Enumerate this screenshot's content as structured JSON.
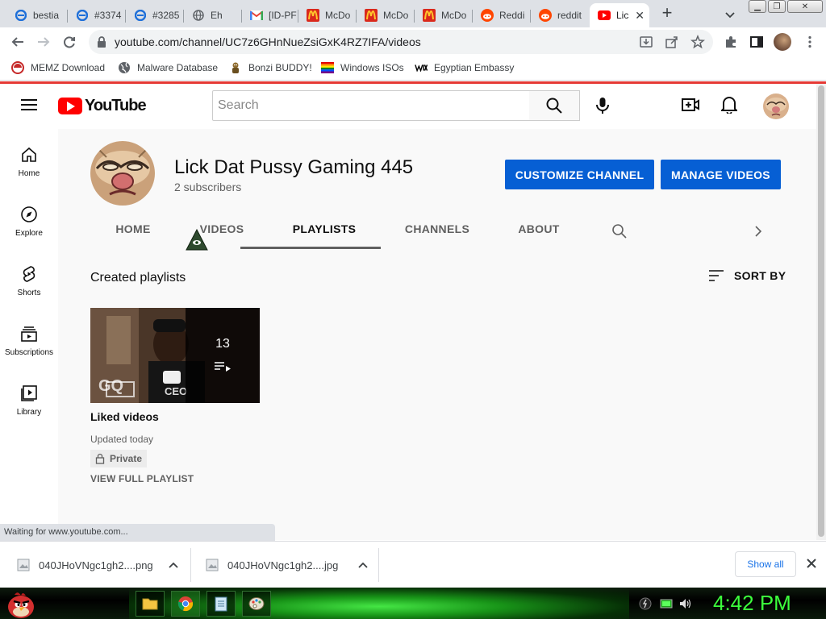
{
  "browser": {
    "tabs": [
      {
        "label": "bestia",
        "icon": "ie-icon"
      },
      {
        "label": "#3374",
        "icon": "ie-icon"
      },
      {
        "label": "#3285",
        "icon": "ie-icon"
      },
      {
        "label": "Eh",
        "icon": "globe-icon"
      },
      {
        "label": "[ID-PF",
        "icon": "gmail-icon"
      },
      {
        "label": "McDo",
        "icon": "mcdonalds-icon"
      },
      {
        "label": "McDo",
        "icon": "mcdonalds-icon"
      },
      {
        "label": "McDo",
        "icon": "mcdonalds-icon"
      },
      {
        "label": "Reddi",
        "icon": "reddit-icon"
      },
      {
        "label": "reddit",
        "icon": "reddit-icon"
      },
      {
        "label": "Lic",
        "icon": "youtube-icon",
        "active": true
      }
    ],
    "url": "youtube.com/channel/UC7z6GHnNueZsiGxK4RZ7IFA/videos",
    "bookmarks": [
      {
        "label": "MEMZ Download",
        "icon": "memz-icon"
      },
      {
        "label": "Malware Database",
        "icon": "globe-icon"
      },
      {
        "label": "Bonzi BUDDY!",
        "icon": "bonzi-icon"
      },
      {
        "label": "Windows ISOs",
        "icon": "rainbow-flag-icon"
      },
      {
        "label": "Egyptian Embassy",
        "icon": "wix-icon"
      }
    ],
    "status_text": "Waiting for www.youtube.com..."
  },
  "youtube": {
    "logo_text": "YouTube",
    "search_placeholder": "Search",
    "guide": [
      {
        "label": "Home",
        "icon": "home-icon"
      },
      {
        "label": "Explore",
        "icon": "compass-icon"
      },
      {
        "label": "Shorts",
        "icon": "shorts-icon"
      },
      {
        "label": "Subscriptions",
        "icon": "subscriptions-icon"
      },
      {
        "label": "Library",
        "icon": "library-icon"
      }
    ],
    "channel": {
      "name": "Lick Dat Pussy Gaming 445",
      "subscribers": "2 subscribers",
      "customize_label": "CUSTOMIZE CHANNEL",
      "manage_label": "MANAGE VIDEOS",
      "tabs": [
        "HOME",
        "VIDEOS",
        "PLAYLISTS",
        "CHANNELS",
        "ABOUT"
      ],
      "active_tab": "PLAYLISTS"
    },
    "section": {
      "title": "Created playlists",
      "sort_label": "SORT BY"
    },
    "playlist": {
      "title": "Liked videos",
      "count": "13",
      "updated": "Updated today",
      "privacy": "Private",
      "view_full": "VIEW FULL PLAYLIST",
      "thumb_watermark": "GQ",
      "thumb_text": "CEO"
    }
  },
  "downloads": {
    "items": [
      {
        "filename": "040JHoVNgc1gh2....png"
      },
      {
        "filename": "040JHoVNgc1gh2....jpg"
      }
    ],
    "show_all": "Show all"
  },
  "taskbar": {
    "clock": "4:42 PM"
  },
  "colors": {
    "youtube_red": "#ff0000",
    "primary_button": "#065fd4",
    "clock_green": "#3cff3c"
  }
}
